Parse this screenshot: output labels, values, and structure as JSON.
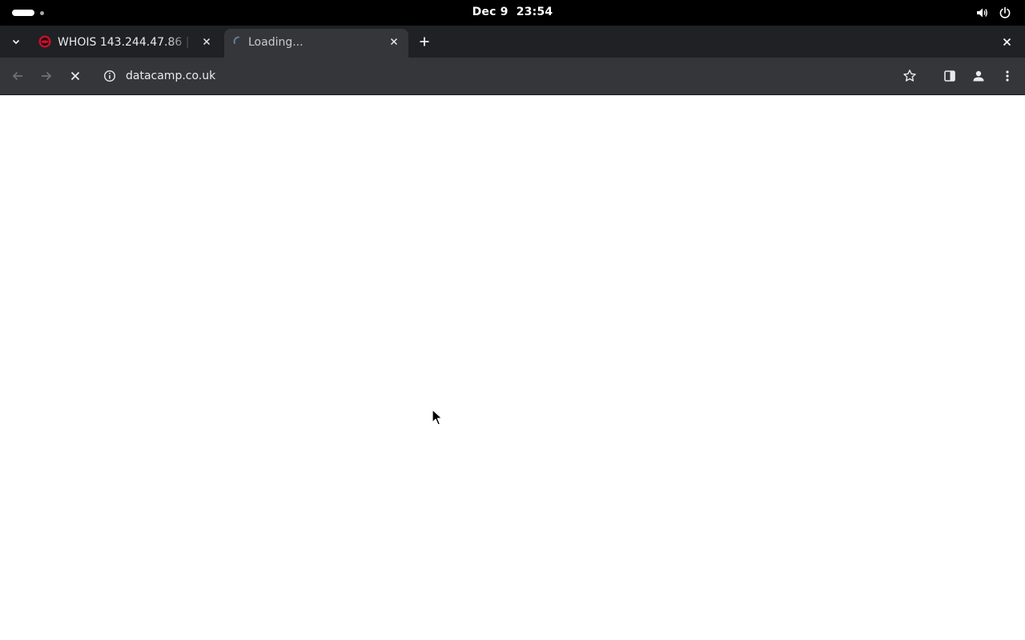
{
  "system_bar": {
    "date": "Dec 9",
    "time": "23:54",
    "icons": [
      "activities-indicator",
      "volume-icon",
      "power-icon"
    ]
  },
  "browser": {
    "tabs": [
      {
        "title": "WHOIS 143.244.47.86 | D",
        "favicon": "site-favicon",
        "active": false
      },
      {
        "title": "Loading...",
        "favicon": "loading-spinner-icon",
        "active": true
      }
    ],
    "toolbar": {
      "url": "datacamp.co.uk",
      "icons": [
        "back-arrow-icon",
        "forward-arrow-icon",
        "stop-loading-icon",
        "site-info-icon",
        "bookmark-star-icon",
        "side-panel-icon",
        "profile-icon",
        "menu-dots-icon"
      ]
    }
  },
  "colors": {
    "system_bar": "#000000",
    "tab_strip": "#202124",
    "toolbar": "#35363a",
    "page": "#ffffff"
  }
}
